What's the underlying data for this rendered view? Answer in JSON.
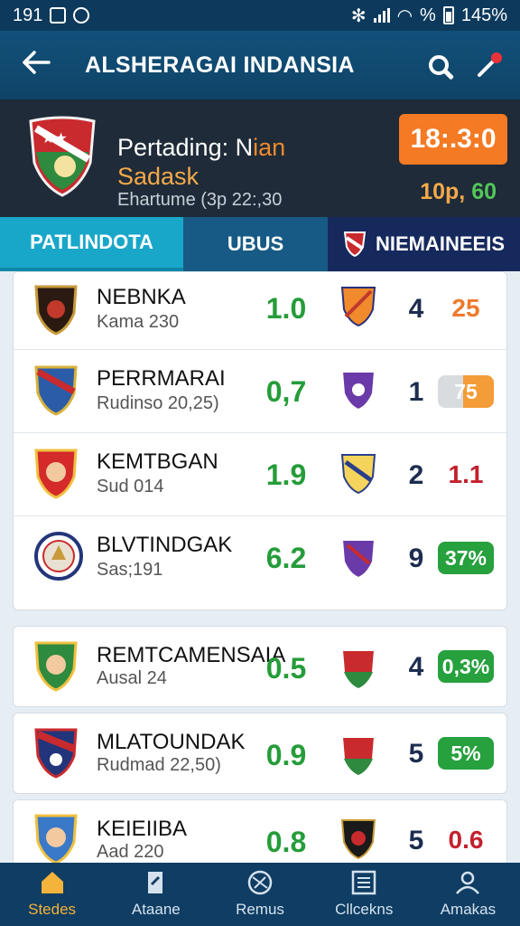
{
  "status_bar": {
    "time": "191",
    "battery": "145%",
    "signal_pct": "%"
  },
  "header": {
    "title": "ALSHERAGAI INDANSIA",
    "icons": [
      "back-arrow-icon",
      "search-icon",
      "pin-icon"
    ]
  },
  "match": {
    "title_prefix": "Pertading: N",
    "title_highlight": "ian",
    "subtitle": "Sadask",
    "time": "Ehartume (3p 22:,30",
    "score": "18:.3:0",
    "odds_a": "10p,",
    "odds_b": "60"
  },
  "tabs": [
    {
      "label": "PATLINDOTA",
      "active": true
    },
    {
      "label": "UBUS",
      "active": false
    },
    {
      "label": "NIEMAINEEIS",
      "active": false
    }
  ],
  "rows": [
    {
      "name": "NEBNKA",
      "sub": "Kama 230",
      "odd": "1.0",
      "num": "4",
      "value": "25",
      "value_style": "plain-orange"
    },
    {
      "name": "PERRMARAI",
      "sub": "Rudinso 20,25)",
      "odd": "0,7",
      "num": "1",
      "value": "75",
      "value_style": "pill-gray"
    },
    {
      "name": "KEMTBGAN",
      "sub": "Sud 014",
      "odd": "1.9",
      "num": "2",
      "value": "1.1",
      "value_style": "plain-red"
    },
    {
      "name": "BLVTINDGAK",
      "sub": "Sas;191",
      "odd": "6.2",
      "num": "9",
      "value": "37%",
      "value_style": "pill-green"
    },
    {
      "name": "REMTCAMENSAIA",
      "sub": "Ausal 24",
      "odd": "0.5",
      "num": "4",
      "value": "0,3%",
      "value_style": "pill-green"
    },
    {
      "name": "MLATOUNDAK",
      "sub": "Rudmad  22,50)",
      "odd": "0.9",
      "num": "5",
      "value": "5%",
      "value_style": "pill-green"
    },
    {
      "name": "KEIEIIBA",
      "sub": "Aad 220",
      "odd": "0.8",
      "num": "5",
      "value": "0.6",
      "value_style": "plain-red"
    }
  ],
  "bottom_nav": [
    {
      "label": "Stedes",
      "icon": "home-icon",
      "active": true
    },
    {
      "label": "Ataane",
      "icon": "flag-icon",
      "active": false
    },
    {
      "label": "Remus",
      "icon": "ball-icon",
      "active": false
    },
    {
      "label": "Cllcekns",
      "icon": "list-icon",
      "active": false
    },
    {
      "label": "Amakas",
      "icon": "user-icon",
      "active": false
    }
  ],
  "colors": {
    "header": "#0f4467",
    "accent": "#f47a23",
    "green": "#27a03e",
    "tab_active": "#19a7c9",
    "nav_active": "#f4b33a"
  }
}
